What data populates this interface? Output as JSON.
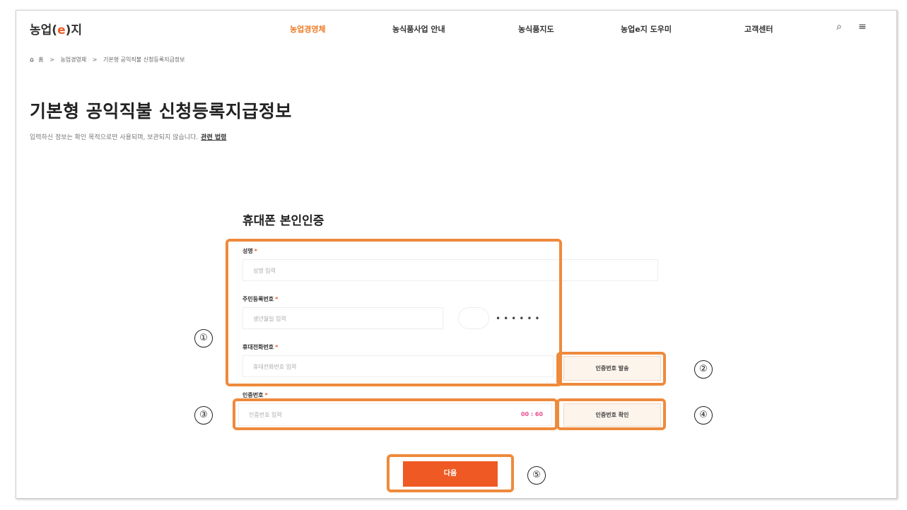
{
  "header": {
    "logo_pre": "농업(",
    "logo_e": "e",
    "logo_post": ")지",
    "nav": [
      "농업경영체",
      "농식품사업 안내",
      "농식품지도",
      "농업e지 도우미",
      "고객센터"
    ],
    "icons": {
      "search": "⌕",
      "menu": "≡"
    }
  },
  "breadcrumb": {
    "home_icon": "⌂",
    "items": [
      "홈",
      "농업경영체",
      "기본형 공익직불 신청등록지급정보"
    ],
    "sep": ">"
  },
  "page": {
    "title": "기본형 공익직불 신청등록지급정보",
    "description": "입력하신 정보는 확인 목적으로만 사용되며, 보관되지 않습니다.",
    "law_link": "관련 법령"
  },
  "form": {
    "title": "휴대폰 본인인증",
    "name_label": "성명",
    "name_placeholder": "성명 입력",
    "rrn_label": "주민등록번호",
    "rrn_placeholder": "생년월일 입력",
    "rrn_masked": "••••••",
    "phone_label": "휴대전화번호",
    "phone_placeholder": "휴대전화번호 입력",
    "send_button": "인증번호 발송",
    "code_label": "인증번호",
    "code_placeholder": "인증번호 입력",
    "timer": "00 : 60",
    "verify_button": "인증번호 확인",
    "next_button": "다음",
    "required_mark": "*"
  },
  "annotations": [
    "①",
    "②",
    "③",
    "④",
    "⑤"
  ],
  "colors": {
    "accent": "#ef5a24",
    "highlight": "#ef8a3c",
    "timer": "#e84f8c"
  }
}
